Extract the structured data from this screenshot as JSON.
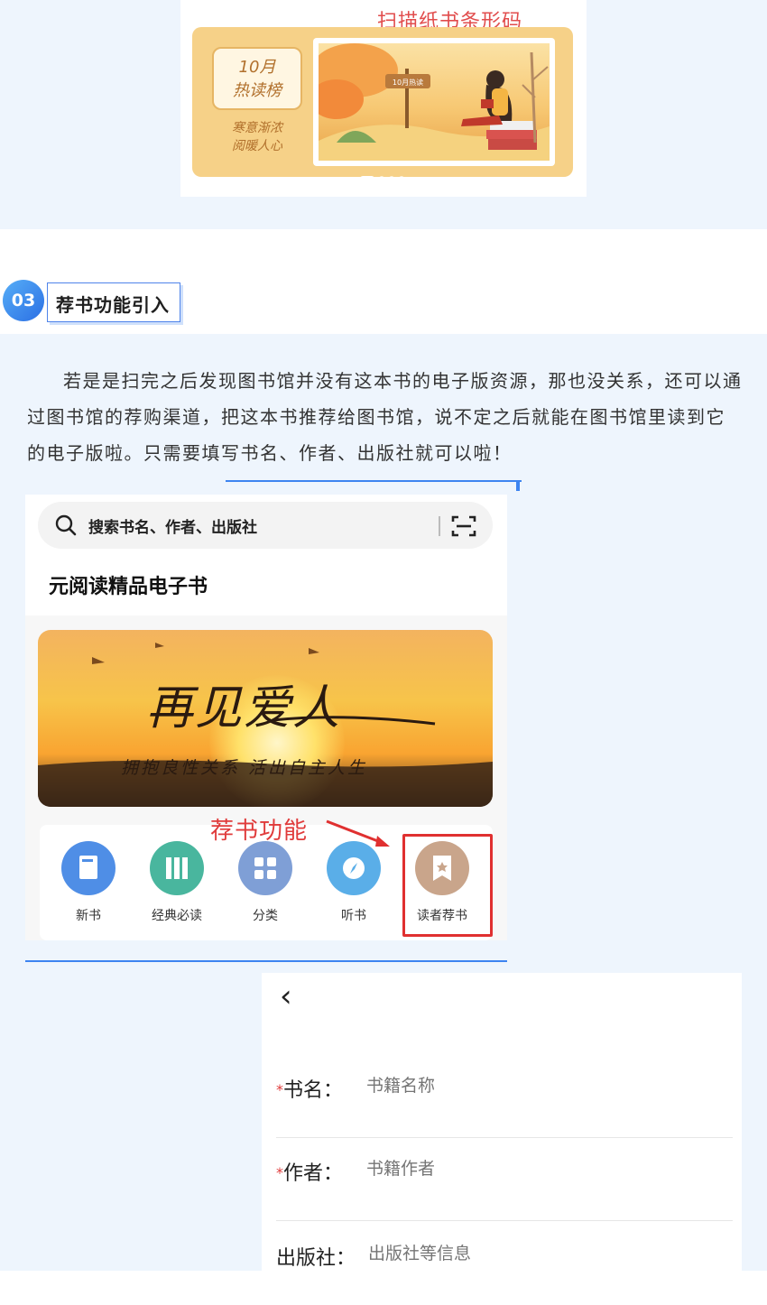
{
  "top_banner": {
    "caption": "扫描纸书条形码",
    "badge_line1": "10月",
    "badge_line2": "热读榜",
    "sub_line1": "寒意渐浓",
    "sub_line2": "阅暖人心",
    "sign_text": "10月热读"
  },
  "section": {
    "number": "03",
    "title": "荐书功能引入",
    "paragraph": "若是是扫完之后发现图书馆并没有这本书的电子版资源，那也没关系，还可以通过图书馆的荐购渠道，把这本书推荐给图书馆，说不定之后就能在图书馆里读到它的电子版啦。只需要填写书名、作者、出版社就可以啦！"
  },
  "app": {
    "search_placeholder": "搜索书名、作者、出版社",
    "title": "元阅读精品电子书",
    "banner_title": "再见爱人",
    "banner_subtitle": "拥抱良性关系 活出自主人生",
    "annotation": "荐书功能",
    "menu": [
      {
        "label": "新书",
        "icon": "new-book-icon",
        "color": "#4f8ee6"
      },
      {
        "label": "经典必读",
        "icon": "classic-books-icon",
        "color": "#49b69e"
      },
      {
        "label": "分类",
        "icon": "category-grid-icon",
        "color": "#7f9fd6"
      },
      {
        "label": "听书",
        "icon": "audiobook-compass-icon",
        "color": "#5aaee8"
      },
      {
        "label": "读者荐书",
        "icon": "reader-recommend-bookmark-icon",
        "color": "#c9a58b"
      }
    ]
  },
  "form": {
    "back_glyph": "‹",
    "fields": [
      {
        "required_mark": "*",
        "label": "书名：",
        "placeholder": "书籍名称"
      },
      {
        "required_mark": "*",
        "label": "作者：",
        "placeholder": "书籍作者"
      },
      {
        "required_mark": "",
        "label": "出版社：",
        "placeholder": "出版社等信息"
      }
    ]
  }
}
